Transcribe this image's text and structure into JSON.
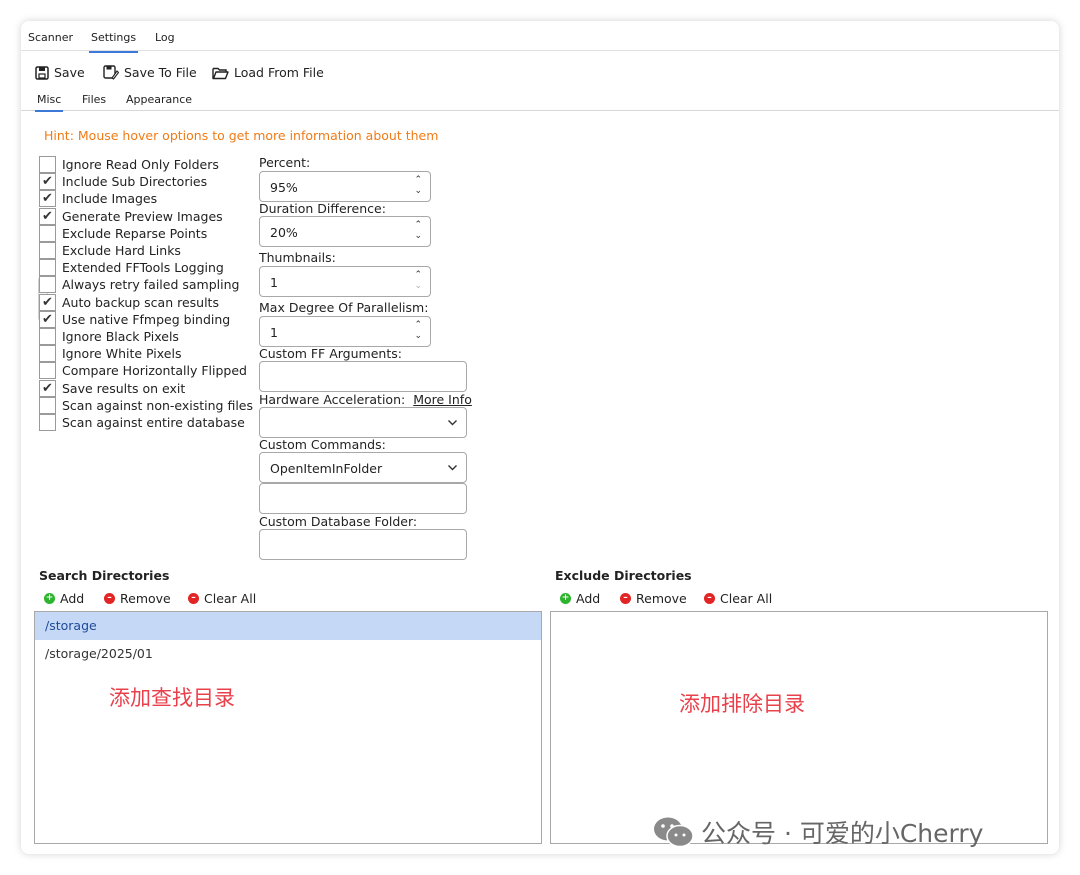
{
  "tabs": [
    "Scanner",
    "Settings",
    "Log"
  ],
  "toolbar": {
    "save": "Save",
    "save_to_file": "Save To File",
    "load_from_file": "Load From File"
  },
  "subtabs": [
    "Misc",
    "Files",
    "Appearance"
  ],
  "hint": "Hint: Mouse hover options to get more information about them",
  "options": [
    {
      "label": "Ignore Read Only Folders",
      "checked": false
    },
    {
      "label": "Include Sub Directories",
      "checked": true
    },
    {
      "label": "Include Images",
      "checked": true
    },
    {
      "label": "Generate Preview Images",
      "checked": true
    },
    {
      "label": "Exclude Reparse Points",
      "checked": false
    },
    {
      "label": "Exclude Hard Links",
      "checked": false
    },
    {
      "label": "Extended FFTools Logging",
      "checked": false
    },
    {
      "label": "Always retry failed sampling",
      "checked": false
    },
    {
      "label": "Auto backup scan results",
      "checked": true
    },
    {
      "label": "Use native Ffmpeg binding",
      "checked": true
    },
    {
      "label": "Ignore Black Pixels",
      "checked": false
    },
    {
      "label": "Ignore White Pixels",
      "checked": false
    },
    {
      "label": "Compare Horizontally Flipped",
      "checked": false
    },
    {
      "label": "Save results on exit",
      "checked": true
    },
    {
      "label": "Scan against non-existing files",
      "checked": false
    },
    {
      "label": "Scan against entire database",
      "checked": false
    }
  ],
  "fields": {
    "percent_label": "Percent:",
    "percent_value": "95%",
    "duration_label": "Duration Difference:",
    "duration_value": "20%",
    "thumbnails_label": "Thumbnails:",
    "thumbnails_value": "1",
    "parallelism_label": "Max Degree Of Parallelism:",
    "parallelism_value": "1",
    "ff_args_label": "Custom FF Arguments:",
    "hw_accel_label": "Hardware Acceleration:",
    "more_info": "More Info",
    "custom_commands_label": "Custom Commands:",
    "custom_commands_value": "OpenItemInFolder",
    "db_folder_label": "Custom Database Folder:"
  },
  "search_dirs": {
    "title": "Search Directories",
    "add": "Add",
    "remove": "Remove",
    "clear_all": "Clear All",
    "items": [
      "/storage",
      "/storage/2025/01"
    ],
    "note": "添加查找目录"
  },
  "exclude_dirs": {
    "title": "Exclude Directories",
    "add": "Add",
    "remove": "Remove",
    "clear_all": "Clear All",
    "items": [],
    "note": "添加排除目录"
  },
  "watermark": "公众号 · 可爱的小Cherry",
  "colors": {
    "accent": "#3b78d8",
    "hint": "#f07b16",
    "selection": "#c5d9f7",
    "note": "#e8414b",
    "add": "#2cb52c",
    "remove": "#e32424"
  }
}
